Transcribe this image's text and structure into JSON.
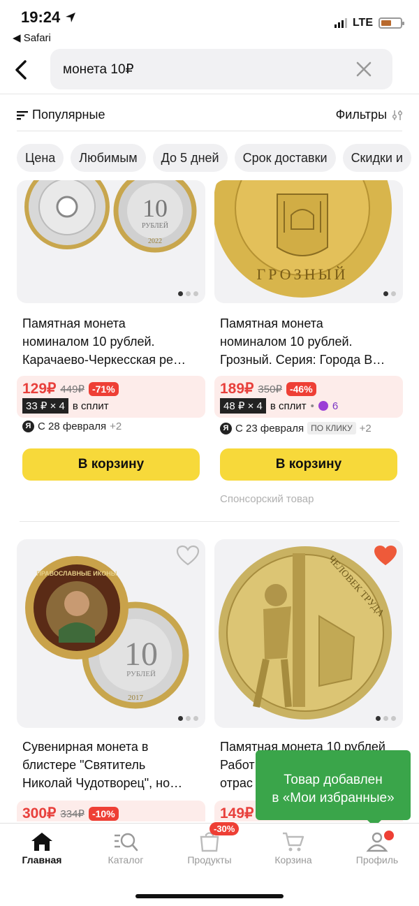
{
  "status_bar": {
    "time": "19:24",
    "back_app": "◀ Safari",
    "network": "LTE",
    "battery_color": "#b8692d"
  },
  "search": {
    "query": "монета 10₽"
  },
  "sort": {
    "label": "Популярные",
    "filters_label": "Фильтры"
  },
  "chips": [
    "Цена",
    "Любимым",
    "До 5 дней",
    "Срок доставки",
    "Скидки и"
  ],
  "products": [
    {
      "title_lines": [
        "Памятная монета",
        "номиналом 10 рублей.",
        "Карачаево-Черкесская ре…"
      ],
      "price": "129₽",
      "old_price": "449₽",
      "discount": "-71%",
      "split_pay": "33 ₽ × 4",
      "split_label": "в сплит",
      "delivery": "С 28 февраля",
      "delivery_extra": "+2",
      "cart_label": "В корзину",
      "coin_text": "10",
      "coin_sub": "РУБЛЕЙ",
      "coin_year": "2022"
    },
    {
      "title_lines": [
        "Памятная монета",
        "номиналом 10 рублей.",
        "Грозный. Серия: Города В…"
      ],
      "price": "189₽",
      "old_price": "350₽",
      "discount": "-46%",
      "split_pay": "48 ₽ × 4",
      "split_label": "в сплит",
      "bonus": "6",
      "delivery": "С 23 февраля",
      "delivery_badge": "ПО КЛИКУ",
      "delivery_extra": "+2",
      "cart_label": "В корзину",
      "sponsor": "Спонсорский товар",
      "coin_text": "ГРОЗНЫЙ"
    },
    {
      "title_lines": [
        "Сувенирная монета в",
        "блистере \"Святитель",
        "Николай Чудотворец\", но…"
      ],
      "price": "300₽",
      "old_price": "334₽",
      "discount": "-10%",
      "coin_text": "10",
      "coin_sub": "РУБЛЕЙ",
      "coin_year": "2017",
      "coin_top": "ПРАВОСЛАВНЫЕ ИКОНЫ"
    },
    {
      "title_lines": [
        "Памятная монета 10 рублей",
        "Работ",
        "отрас"
      ],
      "price": "149₽",
      "coin_text": "ЧЕЛОВЕК ТРУДА"
    }
  ],
  "toast": {
    "line1": "Товар добавлен",
    "line2": "в «Мои избранные»"
  },
  "nav": {
    "home": "Главная",
    "catalog": "Каталог",
    "products": "Продукты",
    "products_badge": "-30%",
    "cart": "Корзина",
    "profile": "Профиль"
  }
}
